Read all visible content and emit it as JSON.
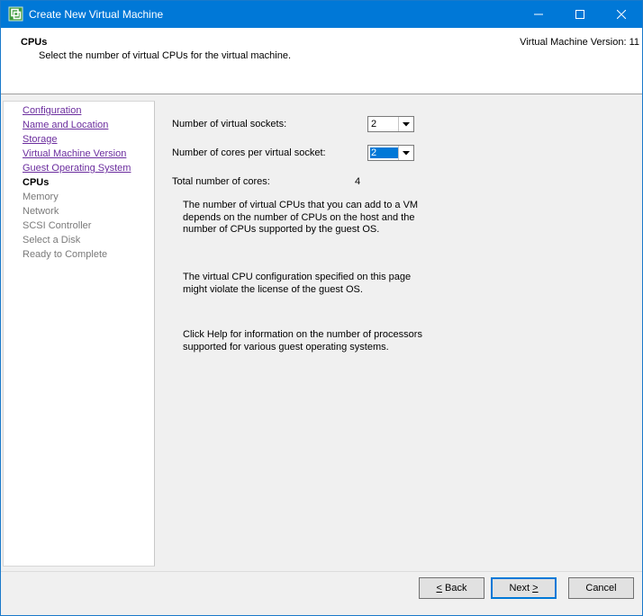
{
  "window": {
    "title": "Create New Virtual Machine",
    "icon": "vsphere-client-icon",
    "controls": [
      "minimize-icon",
      "maximize-icon",
      "close-icon"
    ]
  },
  "header": {
    "title": "CPUs",
    "subtitle": "Select the number of virtual CPUs for the virtual machine.",
    "version": "Virtual Machine Version: 11"
  },
  "nav": {
    "items": [
      {
        "label": "Configuration",
        "state": "done"
      },
      {
        "label": "Name and Location",
        "state": "done"
      },
      {
        "label": "Storage",
        "state": "done"
      },
      {
        "label": "Virtual Machine Version",
        "state": "done"
      },
      {
        "label": "Guest Operating System",
        "state": "done"
      },
      {
        "label": "CPUs",
        "state": "current"
      },
      {
        "label": "Memory",
        "state": "future"
      },
      {
        "label": "Network",
        "state": "future"
      },
      {
        "label": "SCSI Controller",
        "state": "future"
      },
      {
        "label": "Select a Disk",
        "state": "future"
      },
      {
        "label": "Ready to Complete",
        "state": "future"
      }
    ]
  },
  "form": {
    "sockets_label": "Number of virtual sockets:",
    "sockets_value": "2",
    "cores_label": "Number of cores per virtual socket:",
    "cores_value": "2",
    "total_label": "Total number of cores:",
    "total_value": "4",
    "info1": "The number of virtual CPUs that you can add to a VM depends on the number of CPUs on the host and the number of CPUs supported by the guest OS.",
    "info2": "The virtual CPU configuration specified on this page might violate the license of the guest OS.",
    "info3": "Click Help for information on the number of processors supported for various guest operating systems."
  },
  "buttons": {
    "back_mnemonic": "<",
    "back_rest": " Back",
    "next_main": "Next ",
    "next_mnemonic": ">",
    "cancel": "Cancel"
  },
  "colors": {
    "titlebar": "#0078d7",
    "link_done": "#6b2d9e",
    "selection": "#0078d7"
  }
}
